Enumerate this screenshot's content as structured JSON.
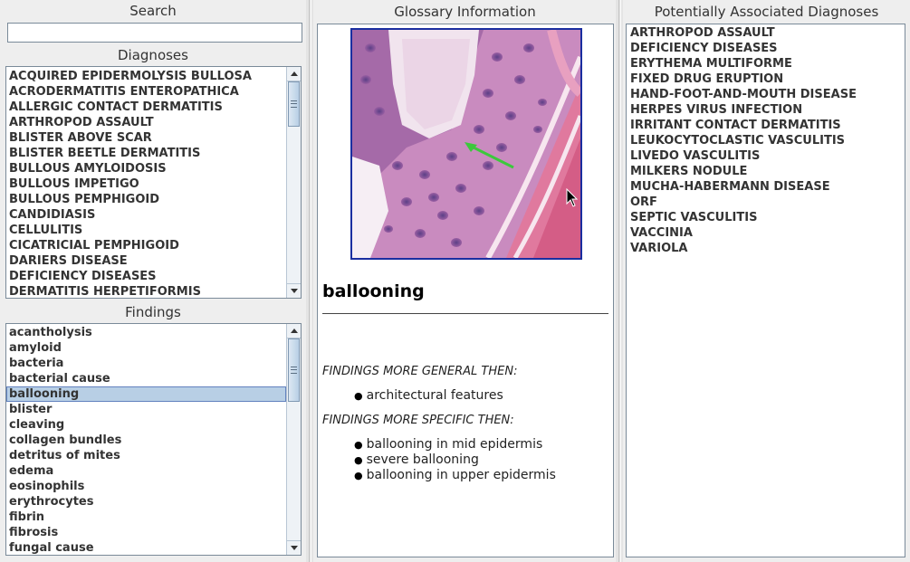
{
  "search": {
    "title": "Search",
    "value": ""
  },
  "diagnoses": {
    "title": "Diagnoses",
    "items": [
      "ACQUIRED EPIDERMOLYSIS BULLOSA",
      "ACRODERMATITIS ENTEROPATHICA",
      "ALLERGIC CONTACT DERMATITIS",
      "ARTHROPOD ASSAULT",
      "BLISTER ABOVE SCAR",
      "BLISTER BEETLE DERMATITIS",
      "BULLOUS AMYLOIDOSIS",
      "BULLOUS IMPETIGO",
      "BULLOUS PEMPHIGOID",
      "CANDIDIASIS",
      "CELLULITIS",
      "CICATRICIAL PEMPHIGOID",
      "DARIERS DISEASE",
      "DEFICIENCY DISEASES",
      "DERMATITIS HERPETIFORMIS"
    ]
  },
  "findings": {
    "title": "Findings",
    "selected": "ballooning",
    "items": [
      "acantholysis",
      "amyloid",
      "bacteria",
      "bacterial cause",
      "ballooning",
      "blister",
      "cleaving",
      "collagen bundles",
      "detritus of mites",
      "edema",
      "eosinophils",
      "erythrocytes",
      "fibrin",
      "fibrosis",
      "fungal cause"
    ]
  },
  "glossary": {
    "title": "Glossary Information",
    "term": "ballooning",
    "general_header": "FINDINGS MORE GENERAL THEN:",
    "general": [
      "architectural features"
    ],
    "specific_header": "FINDINGS MORE SPECIFIC THEN:",
    "specific": [
      "ballooning in mid epidermis",
      "severe ballooning",
      "ballooning in upper epidermis"
    ]
  },
  "associated": {
    "title": "Potentially Associated Diagnoses",
    "items": [
      "ARTHROPOD ASSAULT",
      "DEFICIENCY DISEASES",
      "ERYTHEMA MULTIFORME",
      "FIXED DRUG ERUPTION",
      "HAND-FOOT-AND-MOUTH DISEASE",
      "HERPES VIRUS INFECTION",
      "IRRITANT CONTACT DERMATITIS",
      "LEUKOCYTOCLASTIC VASCULITIS",
      "LIVEDO VASCULITIS",
      "MILKERS NODULE",
      "MUCHA-HABERMANN DISEASE",
      "ORF",
      "SEPTIC VASCULITIS",
      "VACCINIA",
      "VARIOLA"
    ]
  },
  "colors": {
    "selection": "#b8cfe5",
    "image_border": "#1a2ea0",
    "arrow": "#3cc83c"
  },
  "icons": {
    "scroll_up": "arrow-up-icon",
    "scroll_down": "arrow-down-icon",
    "cursor": "mouse-pointer-icon"
  }
}
